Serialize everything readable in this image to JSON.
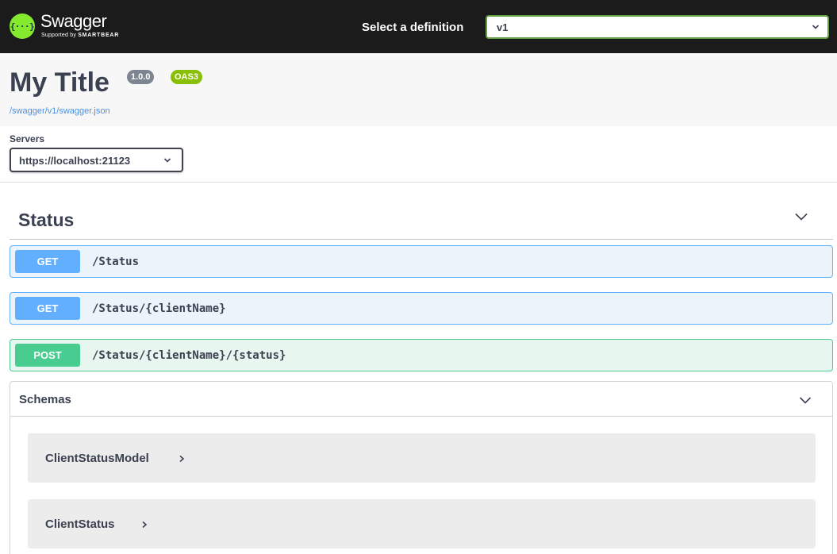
{
  "topbar": {
    "logo_glyph": "{···}",
    "brand": "Swagger",
    "brand_sub_prefix": "Supported by",
    "brand_sub_name": "SMARTBEAR",
    "definition_label": "Select a definition",
    "definition_value": "v1",
    "accent_color": "#85ea2d"
  },
  "info": {
    "title": "My Title",
    "version_badge": "1.0.0",
    "oas_badge": "OAS3",
    "spec_link": "/swagger/v1/swagger.json"
  },
  "servers": {
    "label": "Servers",
    "selected": "https://localhost:21123"
  },
  "tag": {
    "name": "Status",
    "icon": "chevron-down-icon"
  },
  "operations": [
    {
      "method": "GET",
      "path": "/Status",
      "color": "#61affe"
    },
    {
      "method": "GET",
      "path": "/Status/{clientName}",
      "color": "#61affe"
    },
    {
      "method": "POST",
      "path": "/Status/{clientName}/{status}",
      "color": "#49cc90"
    }
  ],
  "schemas": {
    "title": "Schemas",
    "models": [
      {
        "name": "ClientStatusModel"
      },
      {
        "name": "ClientStatus"
      }
    ]
  }
}
